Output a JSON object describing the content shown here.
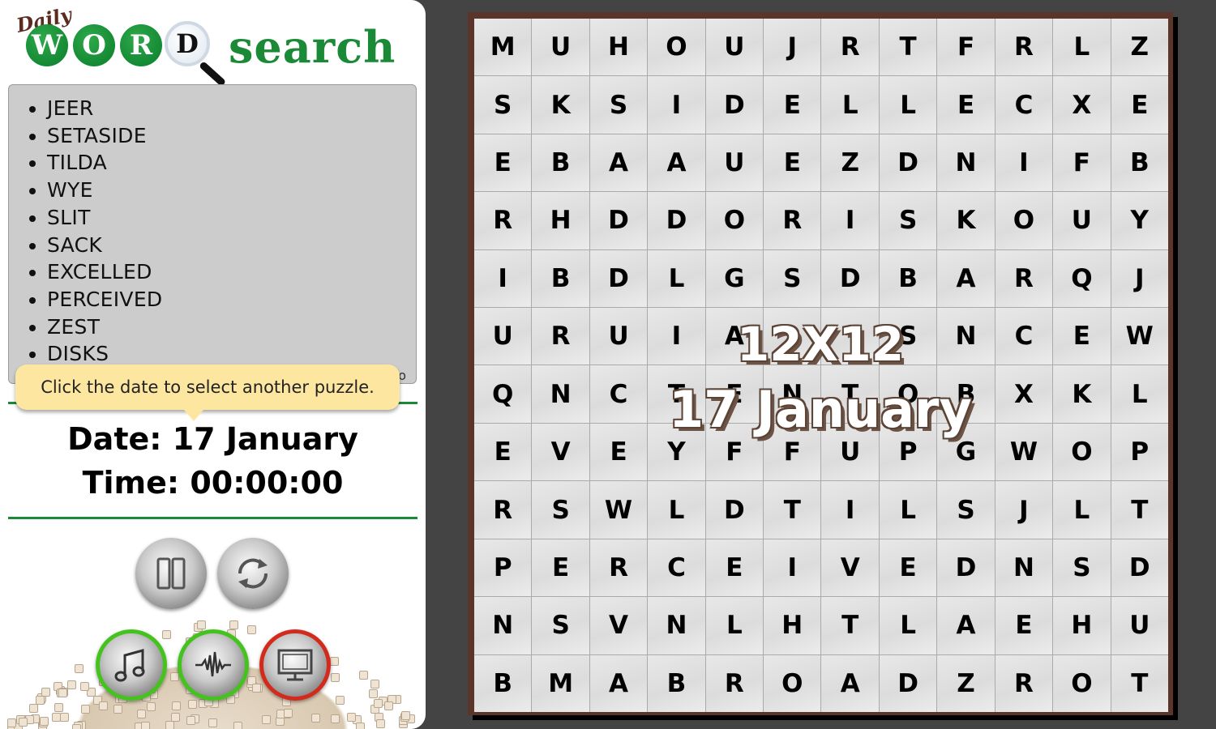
{
  "logo": {
    "daily": "Daily",
    "letters": [
      "W",
      "O",
      "R"
    ],
    "lens_letter": "D",
    "search": "search"
  },
  "word_list": {
    "words": [
      "JEER",
      "SETASIDE",
      "TILDA",
      "WYE",
      "SLIT",
      "SACK",
      "EXCELLED",
      "PERCEIVED",
      "ZEST",
      "DISKS"
    ],
    "more_indicator": "o"
  },
  "tooltip": {
    "text": "Click the date to select another puzzle."
  },
  "info": {
    "date_label": "Date:",
    "date_value": "17 January",
    "time_label": "Time:",
    "time_value": "00:00:00"
  },
  "controls": [
    {
      "name": "pause-button",
      "icon": "pause-icon",
      "state": "neutral"
    },
    {
      "name": "restart-button",
      "icon": "refresh-icon",
      "state": "neutral"
    },
    {
      "name": "music-toggle",
      "icon": "music-note-icon",
      "state": "on"
    },
    {
      "name": "sound-toggle",
      "icon": "sound-wave-icon",
      "state": "on"
    },
    {
      "name": "fullscreen-toggle",
      "icon": "monitor-fullscreen-icon",
      "state": "off"
    }
  ],
  "colors": {
    "brand_green": "#1b8a37",
    "toggle_on": "#44c21d",
    "toggle_off": "#d22b1e",
    "tooltip_bg": "#fde7a0",
    "board_frame": "#5b342a",
    "background": "#444444"
  },
  "board": {
    "size_label": "12X12",
    "date_label": "17 January",
    "rows": [
      [
        "M",
        "U",
        "H",
        "O",
        "U",
        "J",
        "R",
        "T",
        "F",
        "R",
        "L",
        "Z"
      ],
      [
        "S",
        "K",
        "S",
        "I",
        "D",
        "E",
        "L",
        "L",
        "E",
        "C",
        "X",
        "E"
      ],
      [
        "E",
        "B",
        "A",
        "A",
        "U",
        "E",
        "Z",
        "D",
        "N",
        "I",
        "F",
        "B"
      ],
      [
        "R",
        "H",
        "D",
        "D",
        "O",
        "R",
        "I",
        "S",
        "K",
        "O",
        "U",
        "Y"
      ],
      [
        "I",
        "B",
        "D",
        "L",
        "G",
        "S",
        "D",
        "B",
        "A",
        "R",
        "Q",
        "J"
      ],
      [
        "U",
        "R",
        "U",
        "I",
        "A",
        "",
        "",
        "S",
        "N",
        "C",
        "E",
        "W"
      ],
      [
        "Q",
        "N",
        "C",
        "T",
        "E",
        "N",
        "T",
        "O",
        "B",
        "X",
        "K",
        "L"
      ],
      [
        "E",
        "V",
        "E",
        "Y",
        "F",
        "F",
        "U",
        "P",
        "G",
        "W",
        "O",
        "P"
      ],
      [
        "R",
        "S",
        "W",
        "L",
        "D",
        "T",
        "I",
        "L",
        "S",
        "J",
        "L",
        "T"
      ],
      [
        "P",
        "E",
        "R",
        "C",
        "E",
        "I",
        "V",
        "E",
        "D",
        "N",
        "S",
        "D"
      ],
      [
        "N",
        "S",
        "V",
        "N",
        "L",
        "H",
        "T",
        "L",
        "A",
        "E",
        "H",
        "U"
      ],
      [
        "B",
        "M",
        "A",
        "B",
        "R",
        "O",
        "A",
        "D",
        "Z",
        "R",
        "O",
        "T"
      ]
    ]
  }
}
